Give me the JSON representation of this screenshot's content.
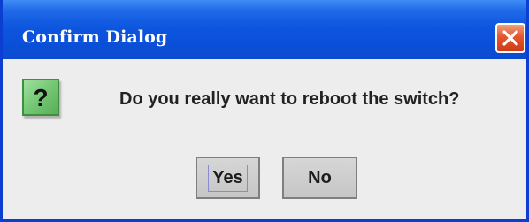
{
  "dialog": {
    "title": "Confirm Dialog",
    "message": "Do you really want to reboot the switch?",
    "icon": "question-icon",
    "close_icon": "close-icon",
    "buttons": {
      "yes_label": "Yes",
      "no_label": "No",
      "focused": "Yes"
    }
  },
  "colors": {
    "titlebar": "#0a4fd8",
    "close_button": "#e4572e",
    "icon_background": "#74c774",
    "body_background": "#ededed"
  }
}
